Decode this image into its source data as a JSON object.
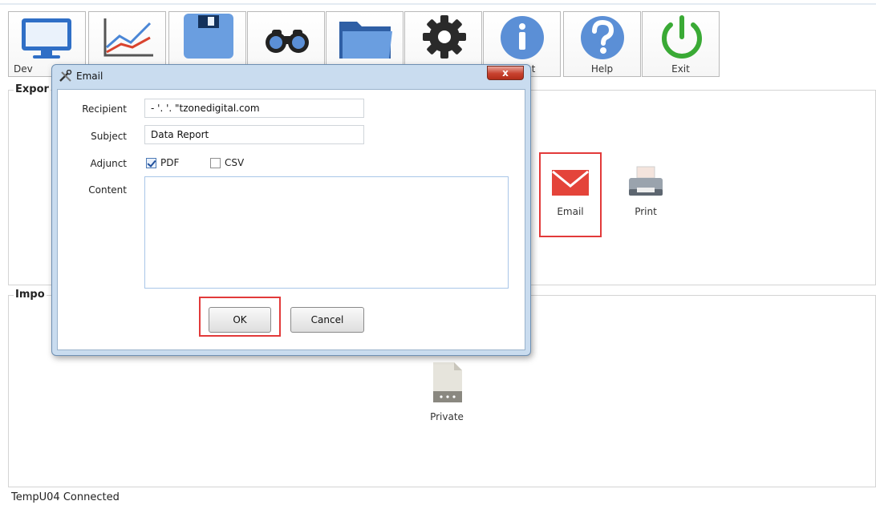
{
  "toolbar": {
    "buttons": [
      {
        "label": "Dev",
        "icon": "monitor-icon"
      },
      {
        "label": "",
        "icon": "line-chart-icon"
      },
      {
        "label": "",
        "icon": "floppy-disk-icon"
      },
      {
        "label": "",
        "icon": "binoculars-icon"
      },
      {
        "label": "",
        "icon": "folder-icon"
      },
      {
        "label": "",
        "icon": "gear-icon"
      },
      {
        "label": "ut",
        "icon": "info-icon"
      },
      {
        "label": "Help",
        "icon": "help-icon"
      },
      {
        "label": "Exit",
        "icon": "power-icon"
      }
    ]
  },
  "export": {
    "title": "Expor",
    "actions": {
      "email": "Email",
      "print": "Print"
    }
  },
  "import": {
    "title": "Impo",
    "actions": {
      "private": "Private"
    }
  },
  "status": {
    "text": "TempU04 Connected"
  },
  "dialog": {
    "title": "Email",
    "close": "x",
    "fields": {
      "recipient_label": "Recipient",
      "recipient_value": "- '. '. \"tzonedigital.com",
      "subject_label": "Subject",
      "subject_value": "Data Report",
      "adjunct_label": "Adjunct",
      "pdf_label": "PDF",
      "pdf_checked": true,
      "csv_label": "CSV",
      "csv_checked": false,
      "content_label": "Content",
      "content_value": ""
    },
    "buttons": {
      "ok": "OK",
      "cancel": "Cancel"
    }
  },
  "colors": {
    "highlight": "#e23a3a",
    "accent_blue": "#5b8fd6",
    "exit_green": "#3aaa35",
    "email_red": "#e4443a"
  }
}
